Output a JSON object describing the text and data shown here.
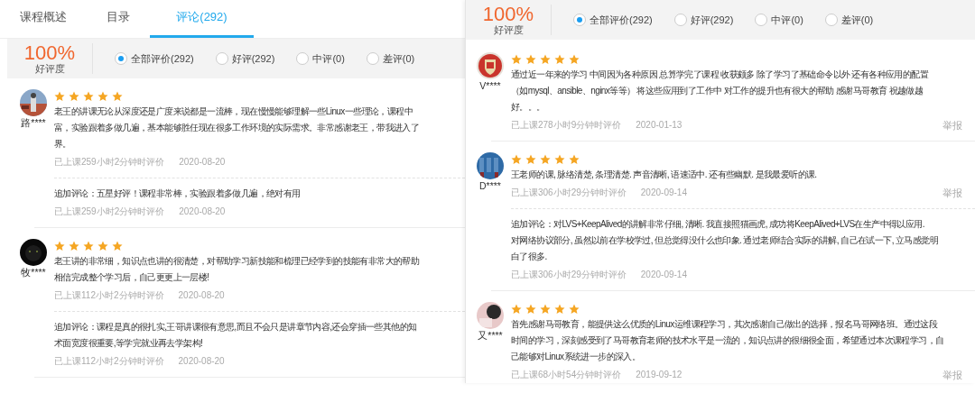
{
  "panels": [
    {
      "tabs": [
        {
          "label": "课程概述",
          "selected": false
        },
        {
          "label": "目录",
          "selected": false
        },
        {
          "label": "评论(292)",
          "selected": true
        }
      ],
      "summary": {
        "rate": "100%",
        "rate_label": "好评度",
        "filters": [
          {
            "label": "全部评价(292)",
            "selected": true
          },
          {
            "label": "好评(292)",
            "selected": false
          },
          {
            "label": "中评(0)",
            "selected": false
          },
          {
            "label": "差评(0)",
            "selected": false
          }
        ]
      },
      "reviews": [
        {
          "user": "路****",
          "stars": 5,
          "lines": [
            "老王的讲课无论从深度还是广度来说都是一流棒，现在慢慢能够理解一些Linux一些理论，课程中",
            "富，实验跟着多做几遍，基本能够胜任现在很多工作环境的实际需求。非常感谢老王，带我进入了",
            "界。"
          ],
          "hours": "已上课259小时2分钟时评价",
          "date": "2020-08-20",
          "followup": {
            "lines": [
              "追加评论：五星好评！课程非常棒，实验跟着多做几遍，绝对有用"
            ],
            "hours": "已上课259小时2分钟时评价",
            "date": "2020-08-20"
          }
        },
        {
          "user": "牧****",
          "stars": 5,
          "lines": [
            "老王讲的非常细，知识点也讲的很清楚，对帮助学习新技能和梳理已经学到的技能有非常大的帮助",
            "相信完成整个学习后，自己更更上一层楼!"
          ],
          "hours": "已上课112小时2分钟时评价",
          "date": "2020-08-20",
          "followup": {
            "lines": [
              "追加评论：课程是真的很扎实,王哥讲课很有意思,而且不会只是讲章节内容,还会穿插一些其他的知",
              "术面宽度很重要,等学完就业再去学架构!"
            ],
            "hours": "已上课112小时2分钟时评价",
            "date": "2020-08-20"
          }
        }
      ]
    },
    {
      "summary": {
        "rate": "100%",
        "rate_label": "好评度",
        "filters": [
          {
            "label": "全部评价(292)",
            "selected": true
          },
          {
            "label": "好评(292)",
            "selected": false
          },
          {
            "label": "中评(0)",
            "selected": false
          },
          {
            "label": "差评(0)",
            "selected": false
          }
        ]
      },
      "reviews": [
        {
          "user": "V****",
          "stars": 5,
          "lines": [
            "通过近一年来的学习 中间因为各种原因 总算学完了课程 收获颇多 除了学习了基础命令以外 还有各种应用的配置",
            "（如mysql、ansible、nginx等等） 将这些应用到了工作中 对工作的提升也有很大的帮助 感谢马哥教育 祝越做越",
            "好。。。"
          ],
          "hours": "已上课278小时9分钟时评价",
          "date": "2020-01-13",
          "report": "举报"
        },
        {
          "user": "D****",
          "stars": 5,
          "lines": [
            "王老师的课, 脉络清楚, 条理清楚. 声音清晰, 语速适中. 还有些幽默. 是我最爱听的课."
          ],
          "hours": "已上课306小时29分钟时评价",
          "date": "2020-09-14",
          "report": "举报",
          "followup": {
            "lines": [
              "追加评论：对LVS+KeepAlived的讲解非常仔细, 清晰. 我直接照猫画虎, 成功将KeepAlived+LVS在生产中得以应用.",
              "对网络协议部分, 虽然以前在学校学过, 但总觉得没什么也印象. 通过老师结合实际的讲解, 自己在试一下, 立马感觉明",
              "白了很多."
            ],
            "hours": "已上课306小时29分钟时评价",
            "date": "2020-09-14"
          }
        },
        {
          "user": "又****",
          "stars": 5,
          "lines": [
            "首先感谢马哥教育，能提供这么优质的Linux运维课程学习，其次感谢自己做出的选择，报名马哥网络班。通过这段",
            "时间的学习，深刻感受到了马哥教育老师的技术水平是一流的，知识点讲的很细很全面，希望通过本次课程学习，自",
            "己能够对Linux系统进一步的深入。"
          ],
          "hours": "已上课68小时54分钟时评价",
          "date": "2019-09-12",
          "report": "举报"
        }
      ]
    }
  ]
}
